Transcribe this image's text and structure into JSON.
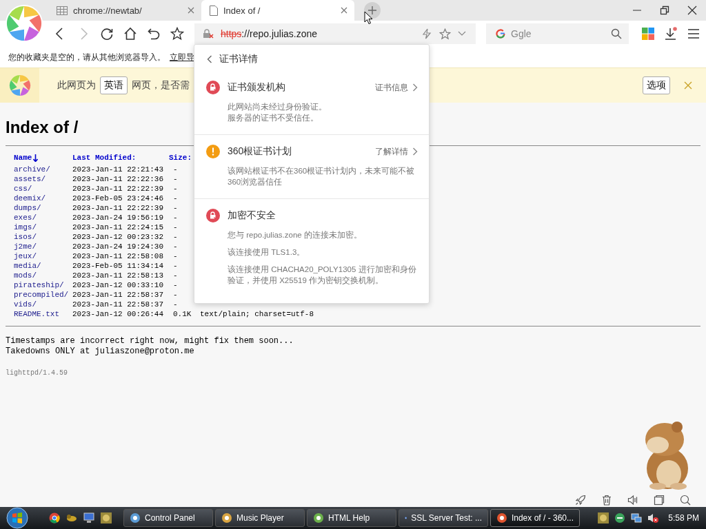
{
  "tabs": [
    {
      "title": "chrome://newtab/",
      "selected": false
    },
    {
      "title": "Index of /",
      "selected": true
    }
  ],
  "address": {
    "scheme": "https",
    "rest": "://repo.julias.zone",
    "secure": false
  },
  "search": {
    "placeholder": "Ggle"
  },
  "bookmarks_bar": {
    "message": "您的收藏夹是空的，请从其他浏览器导入。",
    "link": "立即导"
  },
  "translate_bar": {
    "prefix": "此网页为",
    "language": "英语",
    "suffix": "网页，是否需",
    "options": "选项"
  },
  "page": {
    "title": "Index of /",
    "columns": [
      "Name",
      "Last Modified:",
      "Size:"
    ],
    "rows": [
      {
        "name": "archive/",
        "modified": "2023-Jan-11 22:21:43",
        "size": "-"
      },
      {
        "name": "assets/",
        "modified": "2023-Jan-11 22:22:36",
        "size": "-"
      },
      {
        "name": "css/",
        "modified": "2023-Jan-11 22:22:39",
        "size": "-"
      },
      {
        "name": "deemix/",
        "modified": "2023-Feb-05 23:24:46",
        "size": "-"
      },
      {
        "name": "dumps/",
        "modified": "2023-Jan-11 22:22:39",
        "size": "-"
      },
      {
        "name": "exes/",
        "modified": "2023-Jan-24 19:56:19",
        "size": "-"
      },
      {
        "name": "imgs/",
        "modified": "2023-Jan-11 22:24:15",
        "size": "-"
      },
      {
        "name": "isos/",
        "modified": "2023-Jan-12 00:23:32",
        "size": "-"
      },
      {
        "name": "j2me/",
        "modified": "2023-Jan-24 19:24:30",
        "size": "-"
      },
      {
        "name": "jeux/",
        "modified": "2023-Jan-11 22:58:08",
        "size": "-"
      },
      {
        "name": "media/",
        "modified": "2023-Feb-05 11:34:14",
        "size": "-"
      },
      {
        "name": "mods/",
        "modified": "2023-Jan-11 22:58:13",
        "size": "-"
      },
      {
        "name": "pirateship/",
        "modified": "2023-Jan-12 00:33:10",
        "size": "-"
      },
      {
        "name": "precompiled/",
        "modified": "2023-Jan-11 22:58:37",
        "size": "-"
      },
      {
        "name": "vids/",
        "modified": "2023-Jan-11 22:58:37",
        "size": "-"
      },
      {
        "name": "README.txt",
        "modified": "2023-Jan-12 00:26:44",
        "size": "0.1K",
        "type": "text/plain; charset=utf-8"
      }
    ],
    "notes": [
      "Timestamps are incorrect right now, might fix them soon...",
      "Takedowns ONLY at juliaszone@proton.me"
    ],
    "server": "lighttpd/1.4.59"
  },
  "cert_popup": {
    "title": "证书详情",
    "sections": [
      {
        "kind": "error",
        "title": "证书颁发机构",
        "link": "证书信息",
        "lines": [
          "此网站尚未经过身份验证。",
          "服务器的证书不受信任。"
        ]
      },
      {
        "kind": "warning",
        "title": "360根证书计划",
        "link": "了解详情",
        "lines": [
          "该网站根证书不在360根证书计划内，未来可能不被360浏览器信任"
        ]
      },
      {
        "kind": "error",
        "title": "加密不安全",
        "spaced": true,
        "lines": [
          "您与 repo.julias.zone 的连接未加密。",
          "该连接使用 TLS1.3。",
          "该连接使用 CHACHA20_POLY1305 进行加密和身份验证，并使用 X25519 作为密钥交换机制。"
        ]
      }
    ]
  },
  "taskbar": {
    "items": [
      {
        "label": "Control Panel",
        "selected": false
      },
      {
        "label": "Music Player",
        "selected": false
      },
      {
        "label": "HTML Help",
        "selected": false
      },
      {
        "label": "SSL Server Test: ...",
        "selected": false
      },
      {
        "label": "Index of / - 360...",
        "selected": true
      }
    ],
    "clock": "5:58 PM"
  }
}
